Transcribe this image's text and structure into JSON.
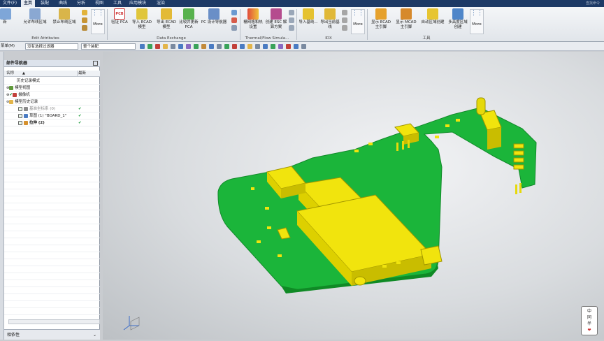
{
  "window": {
    "left_menu": "文件(F)",
    "search_label": "查找命令"
  },
  "menu_tabs": [
    "主页",
    "装配",
    "曲线",
    "分析",
    "视图",
    "工具",
    "应用模块",
    "渲染"
  ],
  "ribbon": {
    "buttons": [
      {
        "id": "new",
        "label": "新"
      },
      {
        "id": "allow-board",
        "label": "允许布线区域"
      },
      {
        "id": "forbid-board",
        "label": "禁止布线区域"
      },
      {
        "id": "verify-pca",
        "label": "验证 PCA"
      },
      {
        "id": "import-ecad",
        "label": "导入 ECAD 模型"
      },
      {
        "id": "export-ecad",
        "label": "导出 ECAD 模型"
      },
      {
        "id": "compare-update",
        "label": "比较并更新 PCA"
      },
      {
        "id": "pc-nav",
        "label": "PC 设计导航器"
      },
      {
        "id": "mesh-thermal",
        "label": "栅网格和热设置"
      },
      {
        "id": "create-esc",
        "label": "创建 ESC 解算方案"
      },
      {
        "id": "import-baseline",
        "label": "导入基线..."
      },
      {
        "id": "export-baseline",
        "label": "导出当前基线"
      },
      {
        "id": "show-ecad",
        "label": "显示 ECAD 主引脚"
      },
      {
        "id": "show-mcad",
        "label": "显示 MCAD 主引脚"
      },
      {
        "id": "auto-region",
        "label": "自动区域创建"
      },
      {
        "id": "multi-height",
        "label": "多高度区域创建"
      }
    ],
    "more": "More",
    "groups": [
      "Edit Attributes",
      "Data Exchange",
      "Thermal/Flow Simula...",
      "IDX",
      "工具"
    ]
  },
  "toolbar2": {
    "menu_label": "菜单(M)",
    "filter_value": "没有选择过滤器",
    "assembly_value": "整个装配"
  },
  "navigator": {
    "title": "部件导航器",
    "col_name": "名称",
    "col_latest": "最新",
    "rows": [
      {
        "label": "历史记录模式",
        "latest": ""
      },
      {
        "label": "模型视图",
        "latest": ""
      },
      {
        "label": "摄像机",
        "latest": ""
      },
      {
        "label": "模型历史记录",
        "latest": ""
      },
      {
        "label": "基准坐标系 (0)",
        "latest": "✔"
      },
      {
        "label": "草图 (1) \"BOARD_1\"",
        "latest": "✔"
      },
      {
        "label": "拉伸 (2)",
        "latest": "✔"
      }
    ],
    "bottom_label": "相依性"
  },
  "stamp": {
    "lines": [
      "中",
      "同",
      "半",
      "❤"
    ]
  },
  "colors": {
    "board": "#1bb53a",
    "component": "#f1e40d",
    "title_bar": "#1d3a66"
  }
}
